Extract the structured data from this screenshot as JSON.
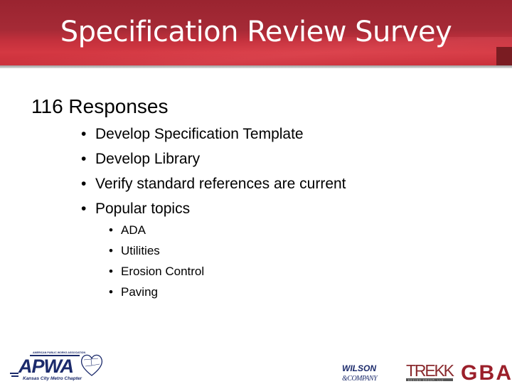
{
  "slide": {
    "title": "Specification Review Survey",
    "heading": "116 Responses",
    "bullets": [
      {
        "text": "Develop Specification Template"
      },
      {
        "text": "Develop Library"
      },
      {
        "text": "Verify standard references are current"
      },
      {
        "text": "Popular topics"
      }
    ],
    "sub_bullets": [
      {
        "text": "ADA"
      },
      {
        "text": "Utilities"
      },
      {
        "text": "Erosion Control"
      },
      {
        "text": "Paving"
      }
    ],
    "bullet_glyph": "•"
  },
  "logos": {
    "apwa": {
      "main": "APWA",
      "top": "AMERICAN PUBLIC WORKS ASSOCIATION",
      "bottom": "Kansas City Metro Chapter",
      "color": "#1b2a6b"
    },
    "wilson": {
      "line1": "WILSON",
      "line2": "&COMPANY",
      "color": "#1b2a6b"
    },
    "trekk": {
      "main": "TREKK",
      "sub": "DESIGN GROUP, LLC",
      "color": "#8a2a2e"
    },
    "gba": {
      "main": "GBA",
      "color": "#9b1f2a"
    }
  },
  "colors": {
    "header_red": "#c3303c",
    "header_dark": "#9a2430"
  }
}
